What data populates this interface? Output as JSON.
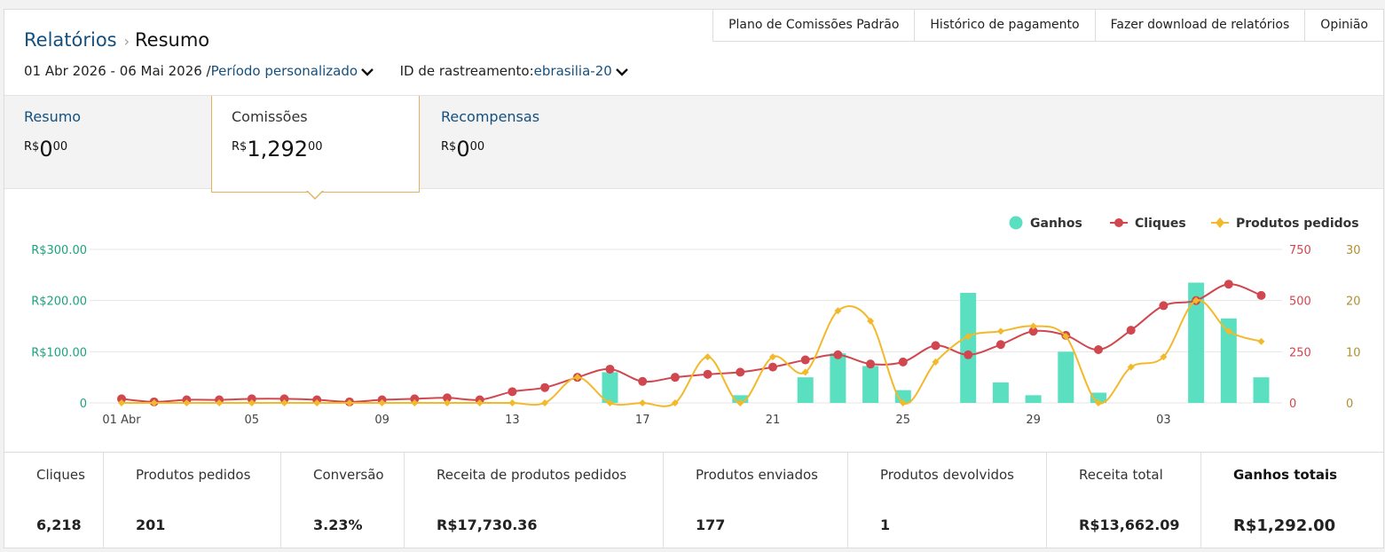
{
  "breadcrumb": {
    "parent": "Relatórios",
    "separator": "›",
    "current": "Resumo"
  },
  "top_buttons": [
    "Plano de Comissões Padrão",
    "Histórico de pagamento",
    "Fazer download de relatórios",
    "Opinião"
  ],
  "filters": {
    "date_range": "01 Abr 2026 - 06 Mai 2026 /",
    "period": "Período personalizado",
    "tracking_label": "ID de rastreamento:",
    "tracking_id": "ebrasilia-20"
  },
  "tabs": [
    {
      "label": "Resumo",
      "currency": "R$",
      "whole": "0",
      "cents": "00"
    },
    {
      "label": "Comissões",
      "currency": "R$",
      "whole": "1,292",
      "cents": "00"
    },
    {
      "label": "Recompensas",
      "currency": "R$",
      "whole": "0",
      "cents": "00"
    }
  ],
  "colors": {
    "ganhos": "#5ae0c0",
    "cliques": "#d0474f",
    "produtos": "#f2b92b",
    "link": "#14507e",
    "left_axis": "#1ca37f",
    "right_axis_2": "#b09030"
  },
  "chart_data": {
    "type": "bar+line",
    "legend": [
      "Ganhos",
      "Cliques",
      "Produtos pedidos"
    ],
    "legend_position": "top-right",
    "grid": true,
    "x_ticks": [
      "01 Abr",
      "05",
      "09",
      "13",
      "17",
      "21",
      "25",
      "29",
      "03"
    ],
    "x_tick_index": [
      0,
      4,
      8,
      12,
      16,
      20,
      24,
      28,
      32
    ],
    "left_axis": {
      "ticks": [
        "R$300.00",
        "R$200.00",
        "R$100.00",
        "0"
      ],
      "range": [
        0,
        300
      ]
    },
    "right_axis_1": {
      "ticks": [
        "750",
        "500",
        "250",
        "0"
      ],
      "range": [
        0,
        750
      ]
    },
    "right_axis_2": {
      "ticks": [
        "30",
        "20",
        "10",
        "0"
      ],
      "range": [
        0,
        30
      ]
    },
    "days": 36,
    "series": [
      {
        "name": "Ganhos",
        "axis": "left",
        "kind": "bar",
        "values": [
          0,
          0,
          0,
          0,
          0,
          0,
          0,
          0,
          0,
          0,
          0,
          0,
          0,
          0,
          0,
          60,
          0,
          0,
          0,
          15,
          0,
          50,
          97,
          72,
          25,
          0,
          215,
          40,
          15,
          100,
          20,
          0,
          0,
          235,
          165,
          50
        ]
      },
      {
        "name": "Cliques",
        "axis": "right_1",
        "kind": "line",
        "values": [
          20,
          5,
          15,
          15,
          20,
          20,
          15,
          5,
          15,
          20,
          25,
          15,
          55,
          75,
          125,
          165,
          105,
          125,
          140,
          150,
          175,
          210,
          235,
          190,
          200,
          280,
          235,
          285,
          350,
          330,
          260,
          355,
          475,
          500,
          580,
          525
        ]
      },
      {
        "name": "Produtos pedidos",
        "axis": "right_2",
        "kind": "line",
        "values": [
          0,
          0,
          0,
          0,
          0,
          0,
          0,
          0,
          0,
          0,
          0,
          0,
          0,
          0,
          5,
          0,
          0,
          0,
          9,
          0,
          9,
          6,
          18,
          16,
          0,
          8,
          13,
          14,
          15,
          13,
          0,
          7,
          9,
          20,
          14,
          12
        ]
      }
    ]
  },
  "stats": [
    {
      "label": "Cliques",
      "value": "6,218"
    },
    {
      "label": "Produtos pedidos",
      "value": "201"
    },
    {
      "label": "Conversão",
      "value": "3.23%"
    },
    {
      "label": "Receita de produtos pedidos",
      "value": "R$17,730.36"
    },
    {
      "label": "Produtos enviados",
      "value": "177"
    },
    {
      "label": "Produtos devolvidos",
      "value": "1"
    },
    {
      "label": "Receita total",
      "value": "R$13,662.09"
    },
    {
      "label": "Ganhos totais",
      "value": "R$1,292.00"
    }
  ]
}
